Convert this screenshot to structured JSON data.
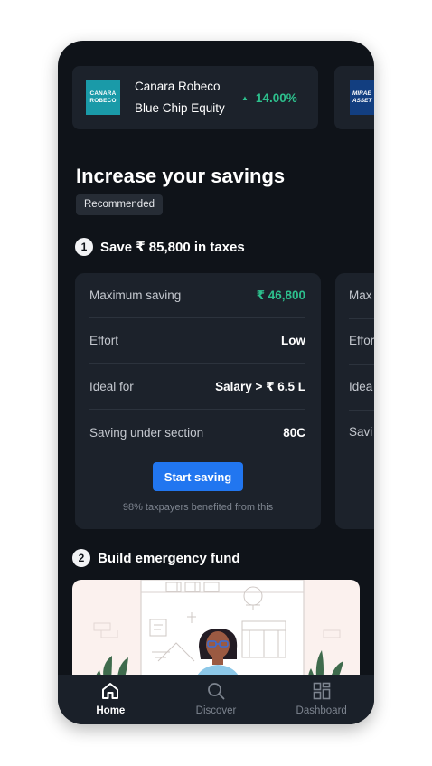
{
  "funds": [
    {
      "logo_line1": "CANARA",
      "logo_line2": "ROBECO",
      "name": "Canara Robeco Blue Chip Equity",
      "change_icon": "triangle-up-icon",
      "change": "14.00%"
    },
    {
      "logo_line1": "MIRAE",
      "logo_line2": "ASSET"
    }
  ],
  "section_title": "Increase your savings",
  "badge": "Recommended",
  "steps": [
    {
      "number": "1",
      "title": "Save ₹ 85,800 in taxes"
    },
    {
      "number": "2",
      "title": "Build emergency fund"
    }
  ],
  "tax_card": {
    "rows": [
      {
        "label": "Maximum saving",
        "value": "₹ 46,800"
      },
      {
        "label": "Effort",
        "value": "Low"
      },
      {
        "label": "Ideal for",
        "value": "Salary > ₹ 6.5 L"
      },
      {
        "label": "Saving under section",
        "value": "80C"
      }
    ],
    "cta": "Start saving",
    "footnote": "98% taxpayers benefited from this"
  },
  "tax_card_peek": [
    "Max",
    "Effor",
    "Idea",
    "Savi"
  ],
  "nav": [
    {
      "label": "Home",
      "icon": "home-icon",
      "active": true
    },
    {
      "label": "Discover",
      "icon": "search-icon",
      "active": false
    },
    {
      "label": "Dashboard",
      "icon": "dashboard-icon",
      "active": false
    }
  ],
  "colors": {
    "accent": "#2176f0",
    "positive": "#2dc08d",
    "background": "#0f1319",
    "card": "#1c222b"
  }
}
